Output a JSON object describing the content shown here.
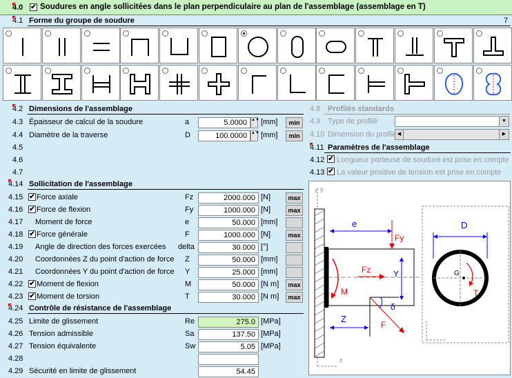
{
  "header": {
    "number": "4.0",
    "title": "Soudures en angle sollicitées dans le plan perpendiculaire au plan de l'assemblage (assemblage en T)"
  },
  "group": {
    "number": "4.1",
    "title": "Forme du groupe de soudure",
    "selected_index": "7"
  },
  "dimensions": {
    "number": "4.2",
    "title": "Dimensions de l'assemblage",
    "rows": [
      {
        "number": "4.3",
        "label": "Épaisseur de calcul de la soudure",
        "sym": "a",
        "value": "5.0000",
        "unit": "[mm]",
        "btn": "min"
      },
      {
        "number": "4.4",
        "label": "Diamètre de la traverse",
        "sym": "D",
        "value": "100.0000",
        "unit": "[mm]",
        "btn": "min"
      }
    ],
    "empty_rows": [
      "4.5",
      "4.6",
      "4.7"
    ]
  },
  "profiles": {
    "number": "4.8",
    "title": "Profilés standards",
    "type_number": "4.9",
    "type_label": "Type de profilé",
    "dim_number": "4.10",
    "dim_label": "Dimension du profilé"
  },
  "params": {
    "number": "4.11",
    "title": "Paramètres de l'assemblage",
    "opt1_number": "4.12",
    "opt1_label": "Longueur porteuse de soudure est prise en compte",
    "opt2_number": "4.13",
    "opt2_label": "La valeur positive de tension est prise en compte"
  },
  "loading": {
    "number": "4.14",
    "title": "Sollicitation de l'assemblage",
    "rows": [
      {
        "number": "4.15",
        "label": "Force axiale",
        "sym": "Fz",
        "value": "2000.000",
        "unit": "[N]",
        "btn": "max",
        "check": true
      },
      {
        "number": "4.16",
        "label": "Force de flexion",
        "sym": "Fy",
        "value": "1000.000",
        "unit": "[N]",
        "btn": "max",
        "check": true
      },
      {
        "number": "4.17",
        "label": "Moment de force",
        "sym": "e",
        "value": "50.000",
        "unit": "[mm]",
        "btn": "",
        "check": false
      },
      {
        "number": "4.18",
        "label": "Force générale",
        "sym": "F",
        "value": "1000.000",
        "unit": "[N]",
        "btn": "max",
        "check": true
      },
      {
        "number": "4.19",
        "label": "Angle de direction des forces exercées",
        "sym": "delta",
        "value": "30.000",
        "unit": "[°]",
        "btn": "",
        "check": false
      },
      {
        "number": "4.20",
        "label": "Coordonnées Z du point d'action de force",
        "sym": "Z",
        "value": "50.000",
        "unit": "[mm]",
        "btn": "",
        "check": false
      },
      {
        "number": "4.21",
        "label": "Coordonnées Y du point d'action de force",
        "sym": "Y",
        "value": "25.000",
        "unit": "[mm]",
        "btn": "",
        "check": false
      },
      {
        "number": "4.22",
        "label": "Moment de flexion",
        "sym": "M",
        "value": "50.000",
        "unit": "[N m]",
        "btn": "max",
        "check": true
      },
      {
        "number": "4.23",
        "label": "Moment de torsion",
        "sym": "T",
        "value": "30.000",
        "unit": "[N m]",
        "btn": "max",
        "check": true
      }
    ]
  },
  "control": {
    "number": "4.24",
    "title": "Contrôle de résistance de l'assemblage",
    "rows": [
      {
        "number": "4.25",
        "label": "Limite de glissement",
        "sym": "Re",
        "value": "275.0",
        "unit": "[MPa]"
      },
      {
        "number": "4.26",
        "label": "Tension admissible",
        "sym": "Sa",
        "value": "137.50",
        "unit": "[MPa]"
      },
      {
        "number": "4.27",
        "label": "Tension équivalente",
        "sym": "Sw",
        "value": "5.05",
        "unit": "[MPa]"
      },
      {
        "number": "4.28",
        "label": "",
        "sym": "",
        "value": "",
        "unit": ""
      },
      {
        "number": "4.29",
        "label": "Sécurité en limite de glissement",
        "sym": "",
        "value": "54.45",
        "unit": ""
      }
    ]
  },
  "diagram_labels": {
    "e": "e",
    "fy": "Fy",
    "fz": "Fz",
    "m": "M",
    "y": "Y",
    "z": "Z",
    "f": "F",
    "delta": "δ",
    "d": "D",
    "g": "G",
    "t": "T",
    "axis_y": "y",
    "axis_z": "z"
  }
}
